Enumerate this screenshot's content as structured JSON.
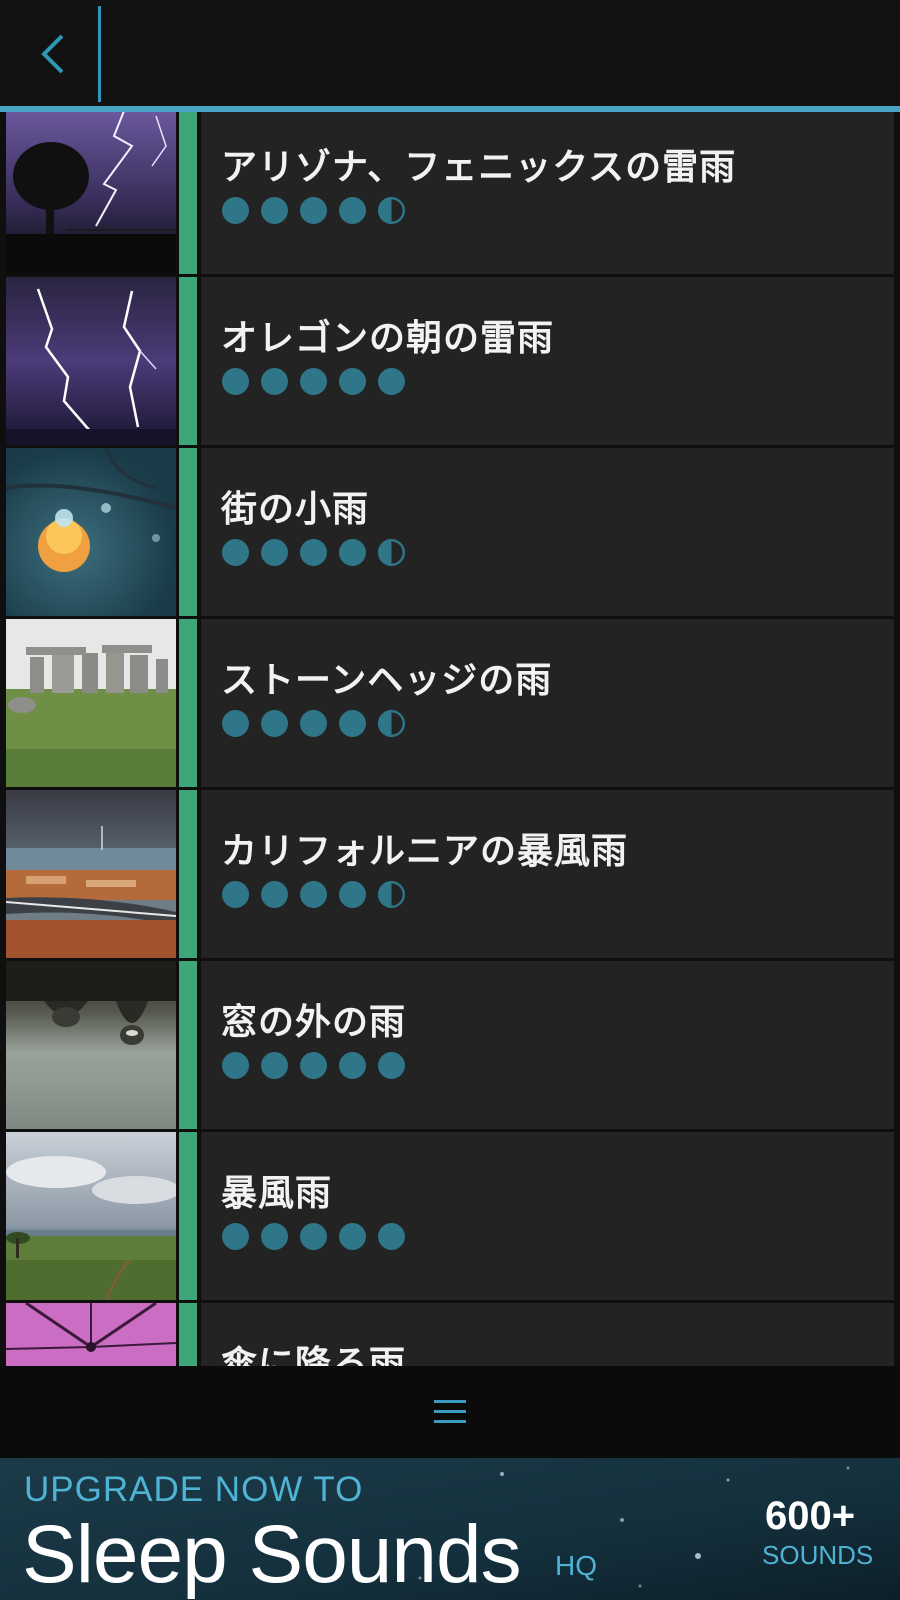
{
  "header": {
    "back_icon": "chevron-left-icon",
    "accent_color": "#4aa3c4"
  },
  "list": {
    "accent_color": "#3fa67a",
    "rating_color": "#2f7688",
    "items": [
      {
        "title": "アリゾナ、フェニックスの雷雨",
        "rating": 4.5,
        "thumb": "lightning-tree"
      },
      {
        "title": "オレゴンの朝の雷雨",
        "rating": 5,
        "thumb": "lightning-purple"
      },
      {
        "title": "街の小雨",
        "rating": 4.5,
        "thumb": "raindrop-city"
      },
      {
        "title": "ストーンヘッジの雨",
        "rating": 4.5,
        "thumb": "stonehenge"
      },
      {
        "title": "カリフォルニアの暴風雨",
        "rating": 4.5,
        "thumb": "storm-coast"
      },
      {
        "title": "窓の外の雨",
        "rating": 5,
        "thumb": "window-drops"
      },
      {
        "title": "暴風雨",
        "rating": 5,
        "thumb": "savanna-clouds"
      },
      {
        "title": "傘に降る雨",
        "rating": null,
        "thumb": "pink-umbrella"
      }
    ]
  },
  "bottom_nav": {
    "menu_icon": "hamburger-menu-icon",
    "icon_color": "#3a9cc0"
  },
  "ad": {
    "line1": "UPGRADE NOW TO",
    "line2": "Sleep Sounds",
    "suffix": "HQ",
    "count": "600+",
    "unit": "SOUNDS"
  }
}
